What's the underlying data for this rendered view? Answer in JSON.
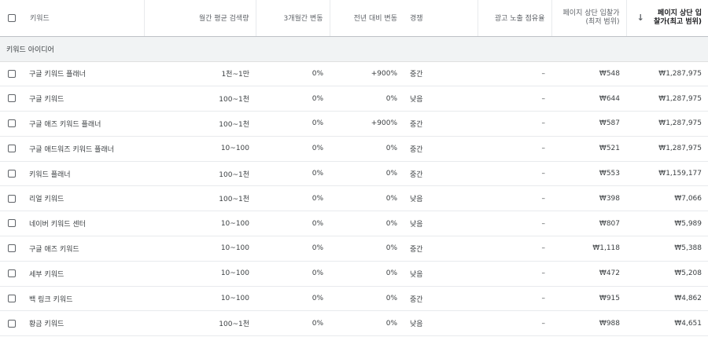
{
  "header": {
    "keyword": "키워드",
    "monthly_searches": "월간 평균 검색량",
    "three_month_change": "3개월간 변동",
    "yoy_change": "전년 대비 변동",
    "competition": "경쟁",
    "ad_impression_share": "광고 노출 점유율",
    "top_bid_low": "페이지 상단 입찰가 (최저 범위)",
    "top_bid_high": "페이지 상단 입찰가(최고 범위)",
    "sort_icon": "arrow-down-icon"
  },
  "section_label": "키워드 아이디어",
  "rows": [
    {
      "keyword": "구글 키워드 플래너",
      "volume": "1천~1만",
      "three_month": "0%",
      "yoy": "+900%",
      "competition": "중간",
      "impression_share": "–",
      "bid_low": "₩548",
      "bid_high": "₩1,287,975"
    },
    {
      "keyword": "구글 키워드",
      "volume": "100~1천",
      "three_month": "0%",
      "yoy": "0%",
      "competition": "낮음",
      "impression_share": "–",
      "bid_low": "₩644",
      "bid_high": "₩1,287,975"
    },
    {
      "keyword": "구글 애즈 키워드 플래너",
      "volume": "100~1천",
      "three_month": "0%",
      "yoy": "+900%",
      "competition": "중간",
      "impression_share": "–",
      "bid_low": "₩587",
      "bid_high": "₩1,287,975"
    },
    {
      "keyword": "구글 애드워즈 키워드 플래너",
      "volume": "10~100",
      "three_month": "0%",
      "yoy": "0%",
      "competition": "중간",
      "impression_share": "–",
      "bid_low": "₩521",
      "bid_high": "₩1,287,975"
    },
    {
      "keyword": "키워드 플래너",
      "volume": "100~1천",
      "three_month": "0%",
      "yoy": "0%",
      "competition": "중간",
      "impression_share": "–",
      "bid_low": "₩553",
      "bid_high": "₩1,159,177"
    },
    {
      "keyword": "리얼 키워드",
      "volume": "100~1천",
      "three_month": "0%",
      "yoy": "0%",
      "competition": "낮음",
      "impression_share": "–",
      "bid_low": "₩398",
      "bid_high": "₩7,066"
    },
    {
      "keyword": "네이버 키워드 센터",
      "volume": "10~100",
      "three_month": "0%",
      "yoy": "0%",
      "competition": "낮음",
      "impression_share": "–",
      "bid_low": "₩807",
      "bid_high": "₩5,989"
    },
    {
      "keyword": "구글 애즈 키워드",
      "volume": "10~100",
      "three_month": "0%",
      "yoy": "0%",
      "competition": "중간",
      "impression_share": "–",
      "bid_low": "₩1,118",
      "bid_high": "₩5,388"
    },
    {
      "keyword": "세부 키워드",
      "volume": "10~100",
      "three_month": "0%",
      "yoy": "0%",
      "competition": "낮음",
      "impression_share": "–",
      "bid_low": "₩472",
      "bid_high": "₩5,208"
    },
    {
      "keyword": "백 링크 키워드",
      "volume": "10~100",
      "three_month": "0%",
      "yoy": "0%",
      "competition": "중간",
      "impression_share": "–",
      "bid_low": "₩915",
      "bid_high": "₩4,862"
    },
    {
      "keyword": "황금 키워드",
      "volume": "100~1천",
      "three_month": "0%",
      "yoy": "0%",
      "competition": "낮음",
      "impression_share": "–",
      "bid_low": "₩988",
      "bid_high": "₩4,651"
    }
  ]
}
